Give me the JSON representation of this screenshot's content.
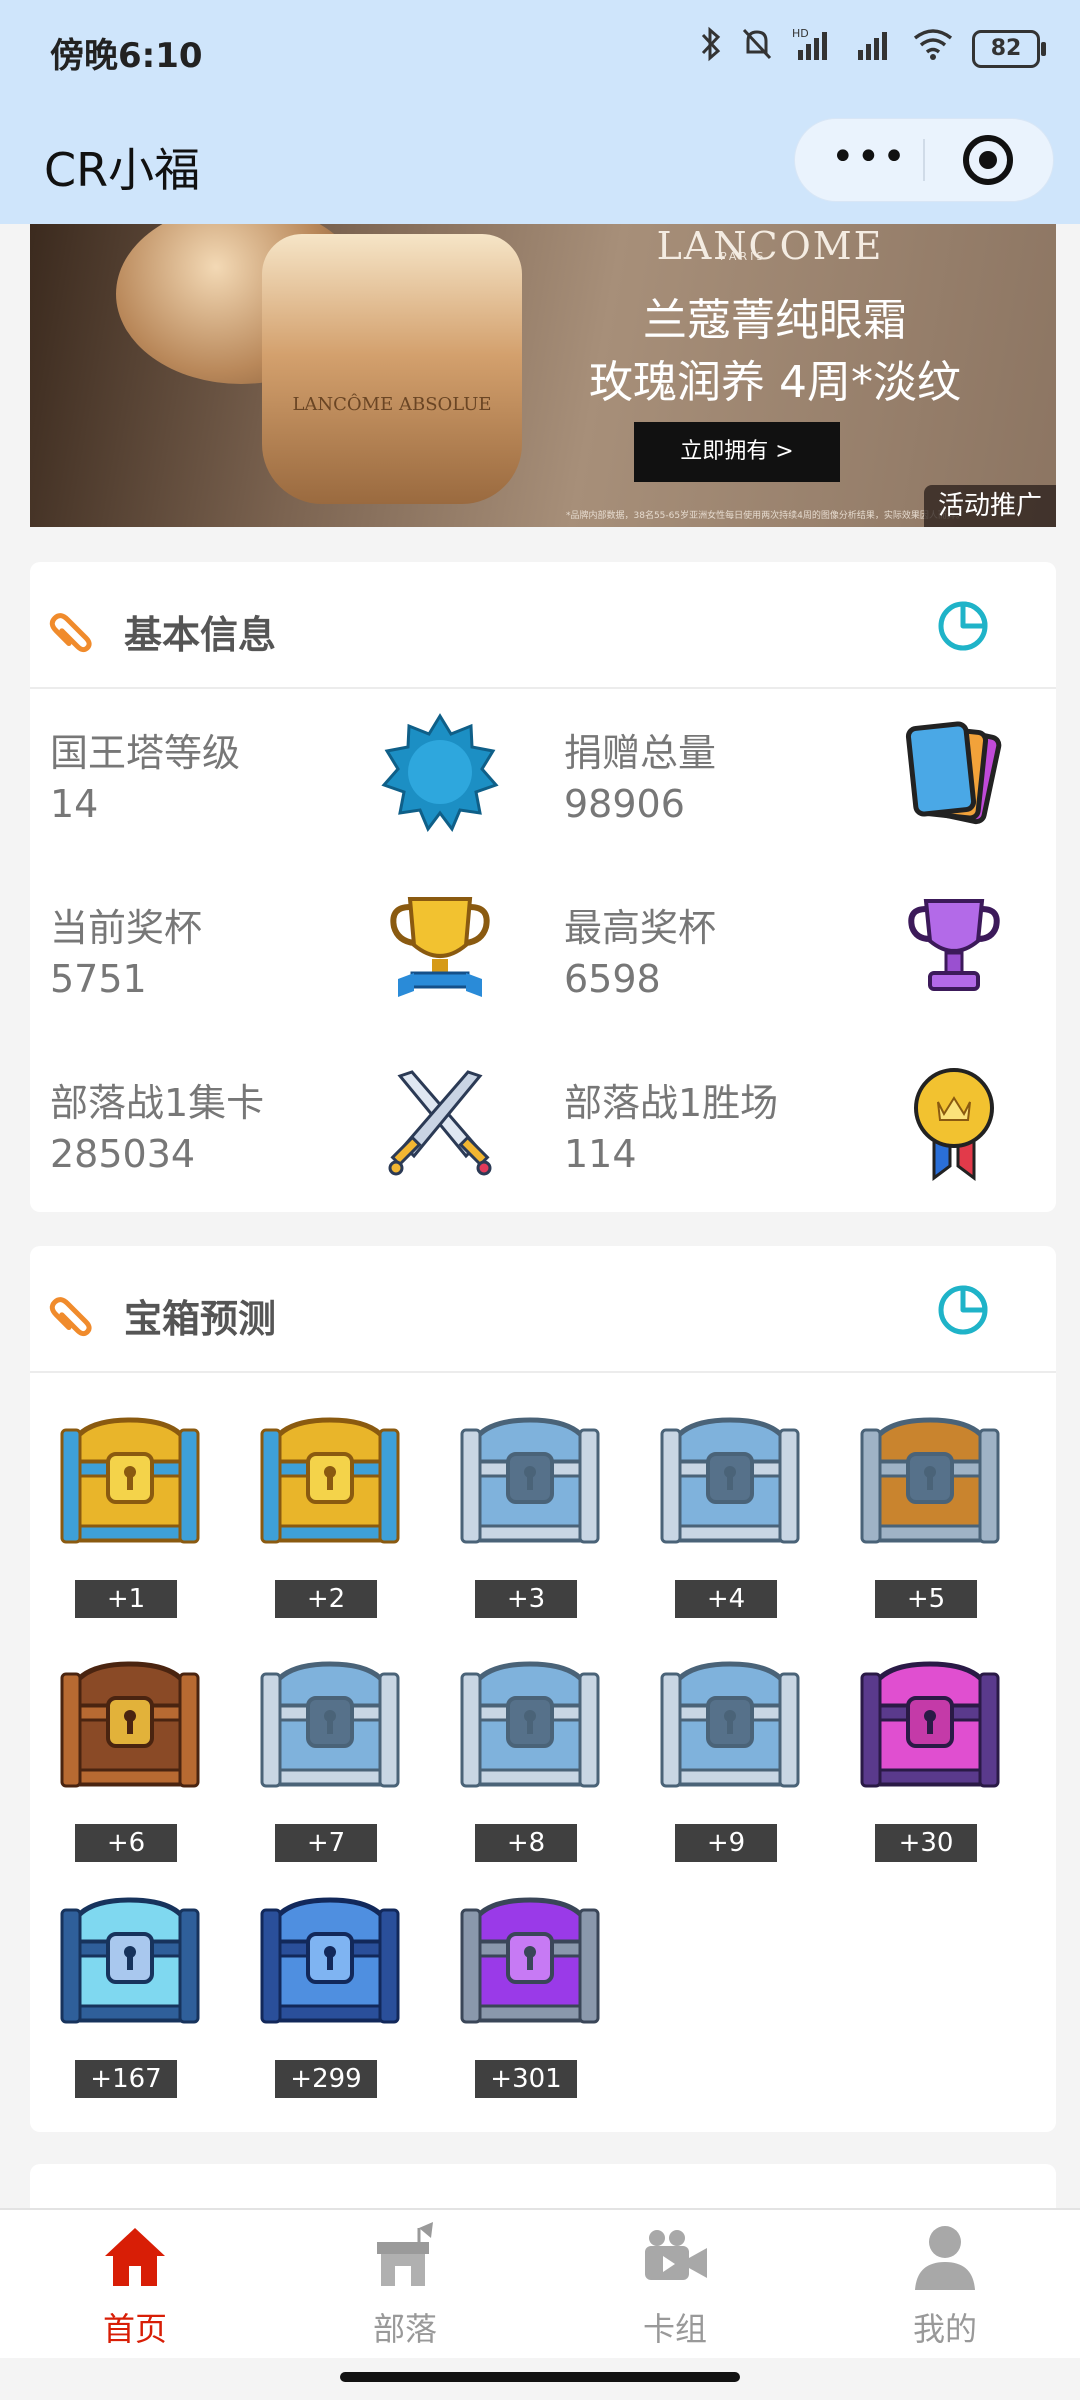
{
  "status_bar": {
    "time": "傍晚6:10",
    "battery": "82"
  },
  "header": {
    "title": "CR小福"
  },
  "banner": {
    "brand": "LANCOME",
    "brand_sub": "PARIS",
    "jar_text": "LANCÔME ABSOLUE",
    "line1": "兰蔻菁纯眼霜",
    "line2": "玫瑰润养 4周*淡纹",
    "button": "立即拥有 >",
    "fine_print": "*品牌内部数据，38名55-65岁亚洲女性每日使用两次持续4周的图像分析结果，实际效果因人而异。",
    "ad_label": "活动推广"
  },
  "basic_info": {
    "title": "基本信息",
    "stats": [
      {
        "label": "国王塔等级",
        "value": "14",
        "icon": "level-badge-icon"
      },
      {
        "label": "捐赠总量",
        "value": "98906",
        "icon": "cards-icon"
      },
      {
        "label": "当前奖杯",
        "value": "5751",
        "icon": "gold-trophy-icon"
      },
      {
        "label": "最高奖杯",
        "value": "6598",
        "icon": "purple-trophy-icon"
      },
      {
        "label": "部落战1集卡",
        "value": "285034",
        "icon": "crossed-swords-icon"
      },
      {
        "label": "部落战1胜场",
        "value": "114",
        "icon": "medal-icon"
      }
    ]
  },
  "chest_prediction": {
    "title": "宝箱预测",
    "chests": [
      {
        "label": "+1",
        "type": "gold"
      },
      {
        "label": "+2",
        "type": "gold"
      },
      {
        "label": "+3",
        "type": "silver"
      },
      {
        "label": "+4",
        "type": "silver"
      },
      {
        "label": "+5",
        "type": "wooden"
      },
      {
        "label": "+6",
        "type": "cage"
      },
      {
        "label": "+7",
        "type": "silver"
      },
      {
        "label": "+8",
        "type": "silver"
      },
      {
        "label": "+9",
        "type": "silver"
      },
      {
        "label": "+30",
        "type": "magical"
      },
      {
        "label": "+167",
        "type": "giant"
      },
      {
        "label": "+299",
        "type": "lightning"
      },
      {
        "label": "+301",
        "type": "epic"
      }
    ]
  },
  "tabs": [
    {
      "label": "首页",
      "icon": "home-icon",
      "active": true
    },
    {
      "label": "部落",
      "icon": "clan-icon",
      "active": false
    },
    {
      "label": "卡组",
      "icon": "deck-icon",
      "active": false
    },
    {
      "label": "我的",
      "icon": "profile-icon",
      "active": false
    }
  ],
  "colors": {
    "accent_orange": "#f08b2c",
    "accent_teal": "#1fb3c8",
    "tab_active": "#d81e06",
    "header_bg": "#cfe5fb"
  }
}
